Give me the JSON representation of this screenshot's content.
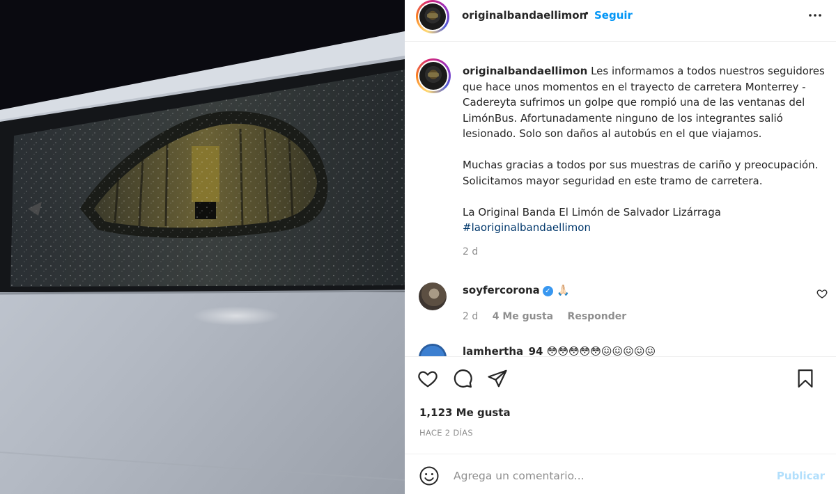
{
  "post": {
    "username": "originalbandaellimon",
    "separator": "•",
    "follow_label": "Seguir",
    "more_icon": "more-horizontal-icon"
  },
  "caption": {
    "username": "originalbandaellimon",
    "paragraph1": "Les informamos a todos nuestros seguidores que hace unos momentos en el trayecto de carretera Monterrey - Cadereyta sufrimos un golpe que rompió una de las ventanas del LimónBus. Afortunadamente ninguno de los integrantes salió lesionado. Solo son daños al autobús en el que viajamos.",
    "paragraph2": "Muchas gracias a todos por sus muestras de cariño y preocupación. Solicitamos mayor seguridad en este tramo de carretera.",
    "paragraph3": "La Original Banda El Limón de Salvador Lizárraga",
    "hashtag": "#laoriginalbandaellimon",
    "time": "2 d"
  },
  "comments": [
    {
      "username": "soyfercorona",
      "verified": true,
      "emoji": "🙏🏻",
      "time": "2 d",
      "likes": "4 Me gusta",
      "reply_label": "Responder"
    },
    {
      "username": "lamhertha_94",
      "emoji": "😳😳😳😳😳😖😖😖😖😖"
    }
  ],
  "actions": {
    "likes": "1,123 Me gusta",
    "time_ago": "HACE 2 DÍAS"
  },
  "add_comment": {
    "placeholder": "Agrega un comentario...",
    "publish_label": "Publicar"
  },
  "colors": {
    "link_blue": "#0095f6",
    "hashtag_blue": "#00376b",
    "publish_disabled": "#b2dffc",
    "secondary_text": "#8e8e8e"
  }
}
